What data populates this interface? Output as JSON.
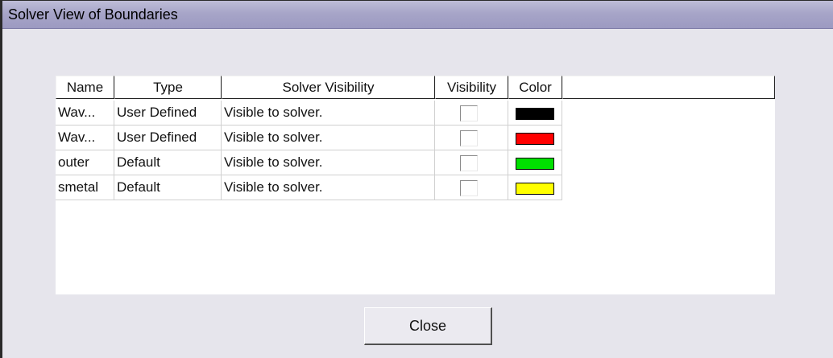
{
  "window": {
    "title": "Solver View of Boundaries"
  },
  "table": {
    "columns": [
      "Name",
      "Type",
      "Solver Visibility",
      "Visibility",
      "Color"
    ],
    "rows": [
      {
        "name": "Wav...",
        "type": "User Defined",
        "solver_visibility": "Visible to solver.",
        "visibility_checked": false,
        "color": "#000000"
      },
      {
        "name": "Wav...",
        "type": "User Defined",
        "solver_visibility": "Visible to solver.",
        "visibility_checked": false,
        "color": "#ff0000"
      },
      {
        "name": "outer",
        "type": "Default",
        "solver_visibility": "Visible to solver.",
        "visibility_checked": false,
        "color": "#00e000"
      },
      {
        "name": "smetal",
        "type": "Default",
        "solver_visibility": "Visible to solver.",
        "visibility_checked": false,
        "color": "#ffff00"
      }
    ]
  },
  "buttons": {
    "close_label": "Close"
  }
}
